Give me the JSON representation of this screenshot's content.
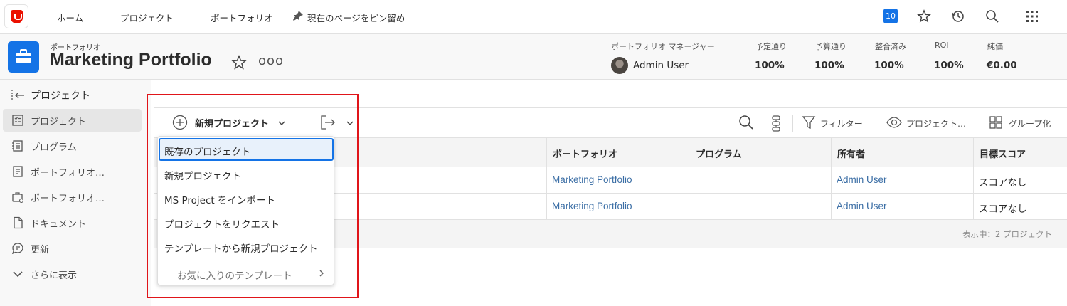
{
  "nav": {
    "home": "ホーム",
    "projects": "プロジェクト",
    "portfolios": "ポートフォリオ",
    "pin_page": "現在のページをピン留め",
    "notification_count": "10"
  },
  "header": {
    "eyebrow": "ポートフォリオ",
    "title": "Marketing Portfolio",
    "more": "ooo",
    "manager_label": "ポートフォリオ マネージャー",
    "manager_name": "Admin User",
    "metrics": [
      {
        "label": "予定通り",
        "value": "100%"
      },
      {
        "label": "予算通り",
        "value": "100%"
      },
      {
        "label": "整合済み",
        "value": "100%"
      },
      {
        "label": "ROI",
        "value": "100%"
      },
      {
        "label": "純価",
        "value": "€0.00"
      }
    ]
  },
  "sidebar": {
    "back_label": "プロジェクト",
    "items": [
      {
        "label": "プロジェクト",
        "icon": "project-list-icon",
        "active": true
      },
      {
        "label": "プログラム",
        "icon": "program-icon"
      },
      {
        "label": "ポートフォリオ…",
        "icon": "portfolio-doc-icon"
      },
      {
        "label": "ポートフォリオ…",
        "icon": "portfolio-settings-icon"
      },
      {
        "label": "ドキュメント",
        "icon": "document-icon"
      },
      {
        "label": "更新",
        "icon": "chat-icon"
      },
      {
        "label": "さらに表示",
        "icon": "chevron-down-icon"
      }
    ]
  },
  "toolbar": {
    "new_project": "新規プロジェクト",
    "filter": "フィルター",
    "view": "プロジェクト…",
    "group": "グループ化"
  },
  "table": {
    "columns": [
      "ポートフォリオ",
      "プログラム",
      "所有者",
      "目標スコア"
    ],
    "rows": [
      {
        "portfolio": "Marketing Portfolio",
        "program": "",
        "owner": "Admin User",
        "score": "スコアなし"
      },
      {
        "portfolio": "Marketing Portfolio",
        "program": "",
        "owner": "Admin User",
        "score": "スコアなし"
      }
    ],
    "footer": "表示中：2 プロジェクト"
  },
  "dropdown": {
    "items": [
      "既存のプロジェクト",
      "新規プロジェクト",
      "MS Project をインポート",
      "プロジェクトをリクエスト",
      "テンプレートから新規プロジェクト"
    ],
    "favorites": "お気に入りのテンプレート"
  },
  "colors": {
    "accent": "#1473e6",
    "highlight": "#e0151a",
    "link": "#3b6ea5"
  }
}
